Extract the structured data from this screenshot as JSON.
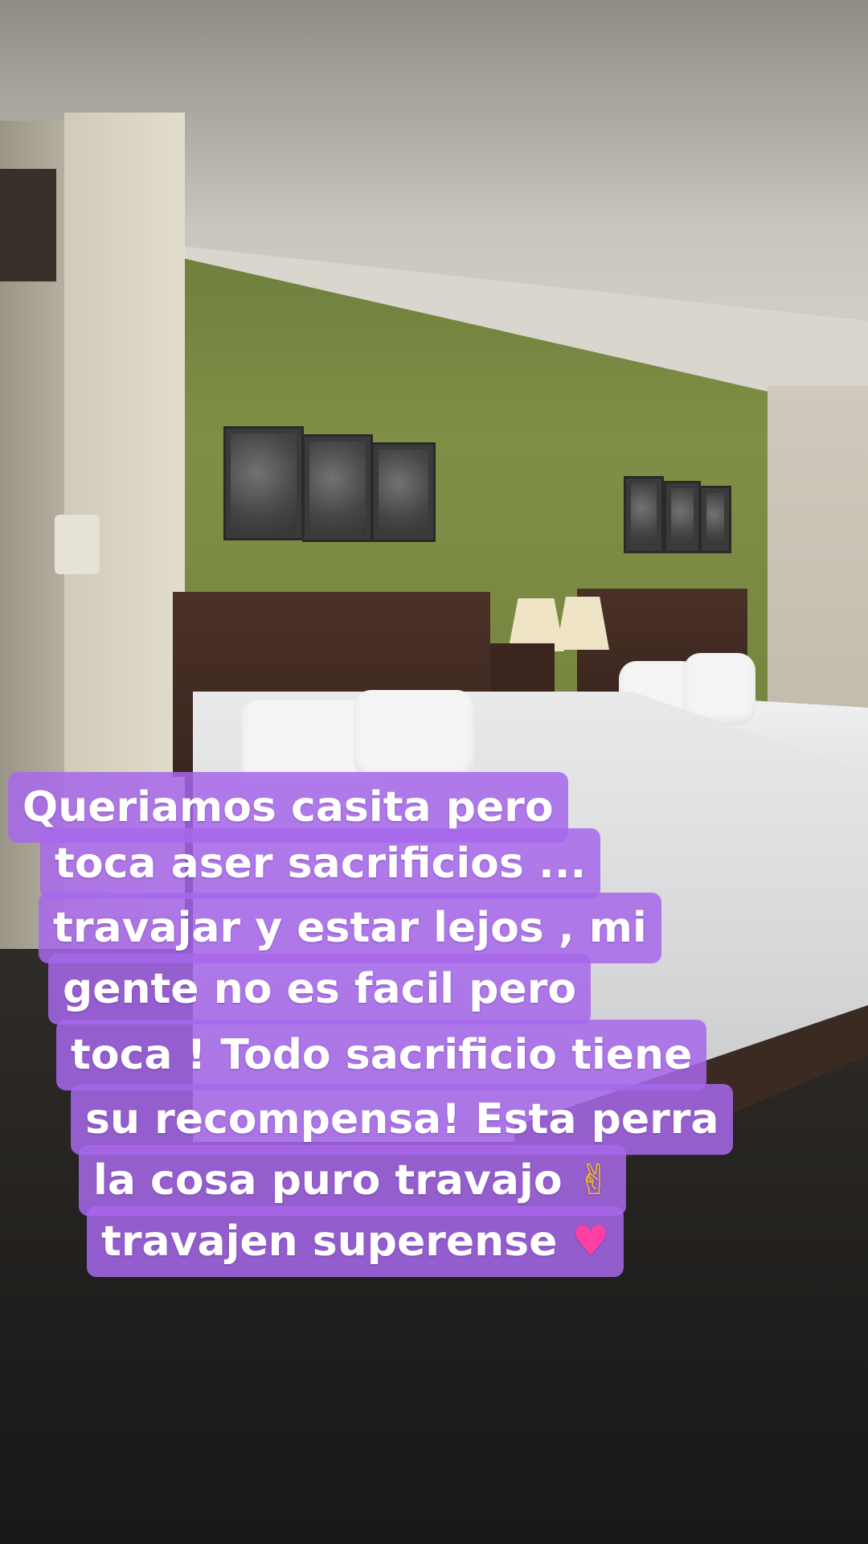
{
  "scene": {
    "description_icons": [
      "hotel-room-photo"
    ]
  },
  "caption": {
    "lines": [
      "Queriamos  casita  pero",
      "toca aser sacrificios ...",
      "travajar y estar lejos , mi",
      "gente no es facil pero",
      "toca ! Todo sacrificio  tiene",
      "su recompensa! Esta  perra",
      "la cosa  puro travajo",
      "travajen superense"
    ],
    "emoji_peace": "✌",
    "emoji_heart": "♥",
    "background_color": "#a668ea",
    "text_color": "#ffffff"
  }
}
